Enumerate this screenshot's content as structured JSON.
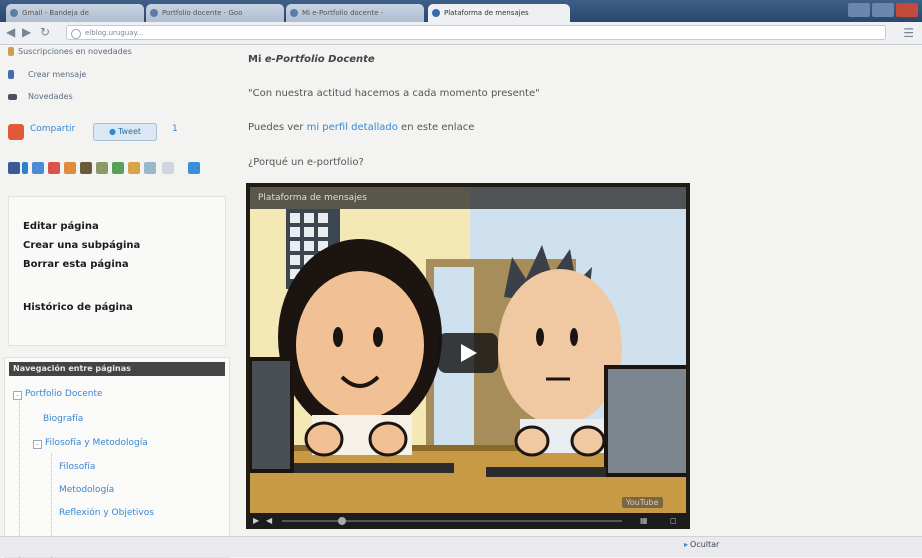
{
  "browser": {
    "tabs": [
      {
        "label": "Gmail - Bandeja de"
      },
      {
        "label": "Portfolio docente - Goo"
      },
      {
        "label": "Mi e-Portfolio docente -"
      },
      {
        "label": "Plataforma de mensajes"
      }
    ],
    "url": "elblog.uruguay..."
  },
  "sidebar": {
    "links": [
      "Suscripciones en novedades",
      "Crear mensaje",
      "Novedades"
    ],
    "share_label": "Compartir",
    "tweet_label": "Tweet",
    "count_label": "1",
    "social_icon_names": [
      "facebook-icon",
      "myspace-icon",
      "delicious-icon",
      "digg-icon",
      "stumbleupon-icon",
      "evernote-icon",
      "reddit-icon",
      "bookmark-icon",
      "more-icon"
    ],
    "actions": [
      "Editar página",
      "Crear una subpágina",
      "Borrar esta página",
      "Histórico de página"
    ],
    "nav_title": "Navegación entre páginas",
    "tree": [
      {
        "label": "Portfolio Docente",
        "level": 0,
        "toggle": "-"
      },
      {
        "label": "Biografía",
        "level": 1
      },
      {
        "label": "Filosofía y Metodología",
        "level": 1,
        "toggle": "-"
      },
      {
        "label": "Filosofía",
        "level": 2
      },
      {
        "label": "Metodología",
        "level": 2
      },
      {
        "label": "Reflexión y Objetivos",
        "level": 2
      }
    ]
  },
  "main": {
    "title_prefix": "Mi ",
    "title_italic": "e-Portfolio Docente",
    "quote": "\"Con nuestra actitud hacemos a cada momento presente\"",
    "link_prefix": "Puedes ver ",
    "link_text": "mi perfil detallado",
    "link_suffix": " en este enlace",
    "question": "¿Porqué un e-portfolio?",
    "video_title": "Plataforma de mensajes",
    "yt_label": "YouTube"
  },
  "footer": {
    "disable_label": "Ocultar"
  },
  "colors": {
    "link": "#3a87d0",
    "tabbar": "#2f4e78",
    "page_bg": "#f3f3f1"
  }
}
